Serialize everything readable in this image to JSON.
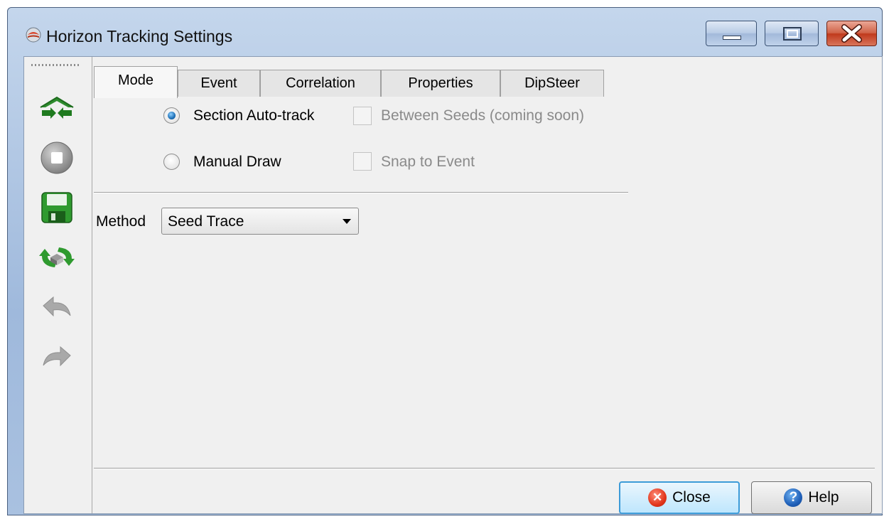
{
  "window": {
    "title": "Horizon Tracking Settings",
    "icon": "horizon-tracking-app-icon",
    "controls": [
      "minimize-icon",
      "maximize-icon",
      "close-icon"
    ],
    "accent_color": "#3c9bd8"
  },
  "toolbar": {
    "items": [
      {
        "icon": "track-horizon-icon",
        "enabled": true
      },
      {
        "icon": "stop-icon",
        "enabled": true
      },
      {
        "icon": "save-icon",
        "enabled": true
      },
      {
        "icon": "retrack-icon",
        "enabled": true
      },
      {
        "icon": "undo-icon",
        "enabled": false
      },
      {
        "icon": "redo-icon",
        "enabled": false
      }
    ]
  },
  "tabs": [
    {
      "label": "Mode",
      "active": true
    },
    {
      "label": "Event",
      "active": false
    },
    {
      "label": "Correlation",
      "active": false
    },
    {
      "label": "Properties",
      "active": false
    },
    {
      "label": "DipSteer",
      "active": false
    }
  ],
  "mode": {
    "section_autotrack_label": "Section Auto-track",
    "section_autotrack_selected": true,
    "between_seeds_label": "Between Seeds (coming soon)",
    "between_seeds_enabled": false,
    "manual_draw_label": "Manual Draw",
    "manual_draw_selected": false,
    "snap_to_event_label": "Snap to Event",
    "snap_to_event_enabled": false
  },
  "method": {
    "label": "Method",
    "selected": "Seed Trace"
  },
  "buttons": {
    "close_label": "Close",
    "help_label": "Help"
  }
}
